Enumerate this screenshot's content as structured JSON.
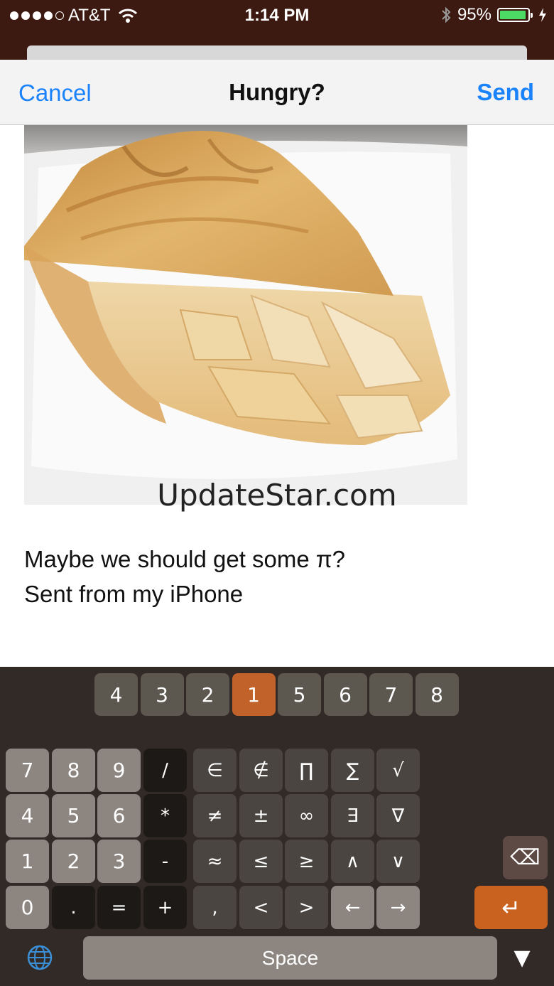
{
  "status_bar": {
    "carrier": "AT&T",
    "time": "1:14 PM",
    "battery_percent": "95%",
    "battery_level": 0.95,
    "icons": [
      "signal-dots-icon",
      "wifi-icon",
      "bluetooth-icon",
      "battery-icon",
      "charging-icon"
    ]
  },
  "compose": {
    "cancel_label": "Cancel",
    "title": "Hungry?",
    "send_label": "Send",
    "accent_color": "#1a82fb"
  },
  "message": {
    "watermark": "UpdateStar.com",
    "line1": "Maybe we should get some π?",
    "line2": "Sent from my iPhone"
  },
  "keyboard": {
    "page_tabs": [
      "4",
      "3",
      "2",
      "1",
      "5",
      "6",
      "7",
      "8"
    ],
    "active_tab": "1",
    "rows": [
      [
        "7",
        "8",
        "9",
        "/",
        "∈",
        "∉",
        "∏",
        "∑",
        "√"
      ],
      [
        "4",
        "5",
        "6",
        "*",
        "≠",
        "±",
        "∞",
        "∃",
        "∇"
      ],
      [
        "1",
        "2",
        "3",
        "-",
        "≈",
        "≤",
        "≥",
        "∧",
        "∨"
      ],
      [
        "0",
        ".",
        "=",
        "+",
        ",",
        "<",
        ">",
        "←",
        "→"
      ]
    ],
    "delete_key": "⌫",
    "return_key": "↵",
    "space_label": "Space",
    "globe_icon": "globe-icon",
    "hide_keyboard": "▼",
    "accent_color": "#c2622b"
  }
}
